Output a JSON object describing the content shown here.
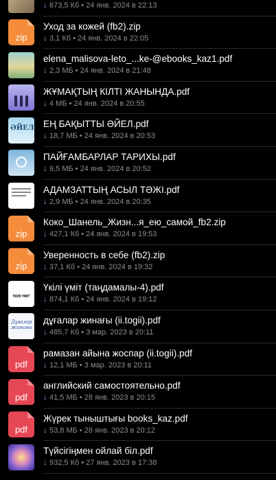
{
  "colors": {
    "background": "#000000",
    "title": "#ffffff",
    "meta": "#8e8e93",
    "download_arrow": "#b18ae6",
    "zip_badge": "#f58c3c",
    "pdf_badge": "#e64755"
  },
  "files": [
    {
      "title": "",
      "meta": "673,5 Кб • 24 янв. 2024 в 22:13",
      "icon": "image-thumbnail",
      "badge": ""
    },
    {
      "title": "Уход за кожей (fb2).zip",
      "meta": "3,1 Кб • 24 янв. 2024 в 22:05",
      "icon": "zip-file-icon",
      "badge": "zip"
    },
    {
      "title": "elena_malisova-leto_...ke-@ebooks_kaz1.pdf",
      "meta": "2,3 МБ • 24 янв. 2024 в 21:48",
      "icon": "book-cover-thumbnail",
      "badge": ""
    },
    {
      "title": "ЖҰМАҚТЫҢ КІЛТІ ЖАНЫНДА.pdf",
      "meta": "4 МБ • 24 янв. 2024 в 20:55",
      "icon": "book-cover-thumbnail",
      "badge": ""
    },
    {
      "title": "ЕҢ БАҚЫТТЫ ӘЙЕЛ.pdf",
      "meta": "18,7 МБ • 24 янв. 2024 в 20:53",
      "icon": "book-cover-thumbnail",
      "badge": "",
      "cover_text": "ӘЙЕЛ"
    },
    {
      "title": "ПАЙҒАМБАРЛАР ТАРИХЫ.pdf",
      "meta": "9,5 МБ • 24 янв. 2024 в 20:52",
      "icon": "book-cover-thumbnail",
      "badge": ""
    },
    {
      "title": "АДАМЗАТТЫҢ АСЫЛ ТӘЖІ.pdf",
      "meta": "2,9 МБ • 24 янв. 2024 в 20:35",
      "icon": "document-thumbnail",
      "badge": ""
    },
    {
      "title": "Коко_Шанель_Жизн...я_ею_самой_fb2.zip",
      "meta": "427,1 Кб • 24 янв. 2024 в 19:53",
      "icon": "zip-file-icon",
      "badge": "zip"
    },
    {
      "title": "Уверенность в себе (fb2).zip",
      "meta": "37,1 Кб • 24 янв. 2024 в 19:32",
      "icon": "zip-file-icon",
      "badge": "zip"
    },
    {
      "title": "Үкілі үміт (таңдамалы-4).pdf",
      "meta": "874,1 Кб • 24 янв. 2024 в 19:12",
      "icon": "document-thumbnail",
      "badge": "",
      "cover_text": "ҮКІЛІ ҮМІТ"
    },
    {
      "title": "дұғалар жинағы (ii.togii).pdf",
      "meta": "485,7 Кб • 3 мар. 2023 в 20:11",
      "icon": "document-thumbnail",
      "badge": "",
      "cover_text": "Дұғалар жинағы"
    },
    {
      "title": "рамазан айына жоспар (ii.togii).pdf",
      "meta": "12,1 МБ • 3 мар. 2023 в 20:11",
      "icon": "pdf-file-icon",
      "badge": "pdf"
    },
    {
      "title": "английский самостоятельно.pdf",
      "meta": "41,5 МБ • 28 янв. 2023 в 20:15",
      "icon": "pdf-file-icon",
      "badge": "pdf"
    },
    {
      "title": "Жүрек тыныштығы books_kaz.pdf",
      "meta": "53,8 МБ • 28 янв. 2023 в 20:12",
      "icon": "pdf-file-icon",
      "badge": "pdf"
    },
    {
      "title": "Түйсігіңмен ойлай біл.pdf",
      "meta": "932,5 Кб • 27 янв. 2023 в 17:38",
      "icon": "book-cover-thumbnail",
      "badge": ""
    }
  ]
}
